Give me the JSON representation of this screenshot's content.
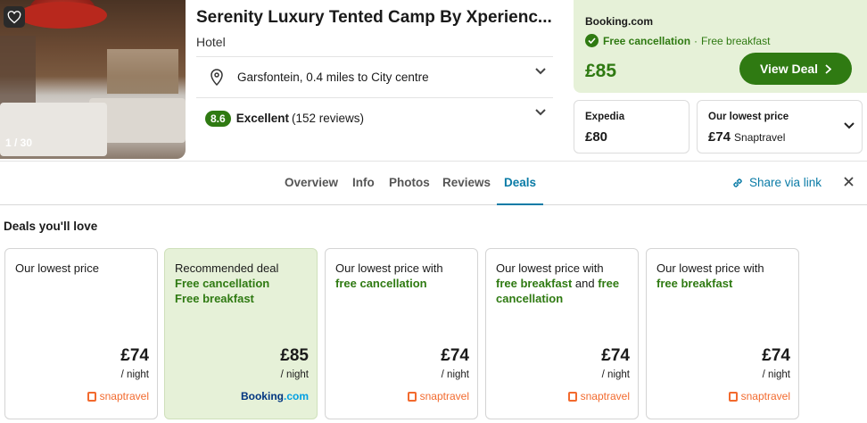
{
  "photo": {
    "counter": "1 / 30"
  },
  "hotel": {
    "title": "Serenity Luxury Tented Camp By Xperienc...",
    "type": "Hotel",
    "location": "Garsfontein, 0.4 miles to City centre",
    "rating_score": "8.6",
    "rating_label": "Excellent",
    "rating_count": "(152 reviews)"
  },
  "featured_deal": {
    "provider": "Booking.com",
    "perk_cancel": "Free cancellation",
    "perk_sep": "·",
    "perk_breakfast": "Free breakfast",
    "price": "£85",
    "cta": "View Deal"
  },
  "alt_deals": [
    {
      "label": "Expedia",
      "price": "£80",
      "sub": ""
    },
    {
      "label": "Our lowest price",
      "price": "£74",
      "sub": "Snaptravel"
    }
  ],
  "tabs": [
    "Overview",
    "Info",
    "Photos",
    "Reviews",
    "Deals"
  ],
  "active_tab": "Deals",
  "share_label": "Share via link",
  "deals_heading": "Deals you'll love",
  "deal_cards": [
    {
      "line1": "Our lowest price",
      "price": "£74",
      "per": "/ night",
      "provider": "snaptravel"
    },
    {
      "line1": "Recommended deal",
      "g1": "Free cancellation",
      "g2": "Free breakfast",
      "price": "£85",
      "per": "/ night",
      "provider_a": "Booking",
      "provider_b": ".com"
    },
    {
      "line1": "Our lowest price with",
      "g1": "free cancellation",
      "price": "£74",
      "per": "/ night",
      "provider": "snaptravel"
    },
    {
      "line1": "Our lowest price with",
      "g1": "free breakfast",
      "mid": " and ",
      "g2": "free cancellation",
      "price": "£74",
      "per": "/ night",
      "provider": "snaptravel"
    },
    {
      "line1": "Our lowest price with",
      "g1": "free breakfast",
      "price": "£74",
      "per": "/ night",
      "provider": "snaptravel"
    }
  ],
  "colors": {
    "accent_green": "#2f7a12",
    "link_blue": "#0a7ba6",
    "deal_bg": "#e6f1d8",
    "snap_orange": "#f26a2e"
  }
}
